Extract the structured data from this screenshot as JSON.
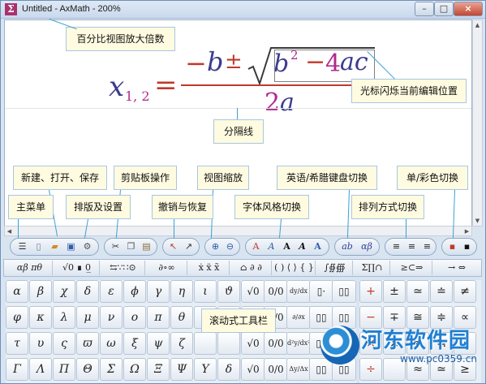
{
  "window": {
    "title": "Untitled - AxMath - 200%",
    "app_icon": "Σ",
    "min_label": "–",
    "max_label": "□",
    "close_label": "×"
  },
  "formula": {
    "x": "x",
    "sub": "1, 2",
    "eq": "=",
    "minus": "−",
    "b": "b",
    "pm": "±",
    "b2": "b",
    "exp": "2",
    "minus2": "−",
    "four": "4",
    "ac": "ac",
    "two": "2",
    "a": "a"
  },
  "callouts": {
    "zoom_percent": "百分比视图放大倍数",
    "cursor_position": "光标闪烁当前编辑位置",
    "separator": "分隔线",
    "new_open_save": "新建、打开、保存",
    "clipboard": "剪贴板操作",
    "view_zoom": "视图缩放",
    "lang_keyboard": "英语/希腊键盘切换",
    "mono_color": "单/彩色切换",
    "main_menu": "主菜单",
    "layout_settings": "排版及设置",
    "undo_redo": "撤销与恢复",
    "font_style": "字体风格切换",
    "align": "排列方式切换",
    "scroll_toolbar": "滚动式工具栏"
  },
  "toolbar": {
    "icons": [
      "menu-icon",
      "new-file-icon",
      "open-folder-icon",
      "save-icon",
      "settings-icon",
      "cut-icon",
      "copy-icon",
      "paste-icon",
      "undo-icon",
      "redo-icon",
      "zoom-in-icon",
      "zoom-out-icon",
      "font-A-red-icon",
      "font-A-italic-icon",
      "font-A-bold-icon",
      "font-A-bold-italic-icon",
      "font-A-blue-icon",
      "english-keyboard-icon",
      "greek-keyboard-icon",
      "align-left-icon",
      "align-center-icon",
      "align-right-icon",
      "color-mode-icon",
      "mono-mode-icon"
    ],
    "font_a": "A",
    "lang_ab": "ab",
    "lang_alpha": "αβ"
  },
  "category_tabs": [
    "αβ πθ",
    "√0 ∎ 0̲",
    "⇆∵∷⊙",
    "∂∘∞",
    "ẋ ẍ x̃",
    "⌂ ∂ ∂",
    "( ) ⟨ ⟩ { }",
    "∫∯∰",
    "Σ∏∩",
    "≥⊂⇒",
    "→ ⇔"
  ],
  "symbols": [
    [
      "α",
      "β",
      "χ",
      "δ",
      "ε",
      "ϕ",
      "γ",
      "η",
      "ι",
      "ϑ"
    ],
    [
      "φ",
      "κ",
      "λ",
      "μ",
      "ν",
      "ο",
      "π",
      "θ",
      "",
      ""
    ],
    [
      "τ",
      "υ",
      "ς",
      "ϖ",
      "ω",
      "ξ",
      "ψ",
      "ζ",
      "",
      ""
    ],
    [
      "Γ",
      "Λ",
      "Π",
      "Θ",
      "Σ",
      "Ω",
      "Ξ",
      "Ψ",
      "Υ",
      "δ"
    ]
  ],
  "struct_symbols": [
    [
      "√0",
      "0/0",
      "dy/dx",
      "▯·",
      "▯▯"
    ],
    [
      "√0",
      "0/0",
      "∂/∂x",
      "▯▯",
      "▯▯"
    ],
    [
      "√0",
      "0/0",
      "d²y/dx²",
      "▯▯",
      "▯▯"
    ],
    [
      "√0",
      "0/0",
      "Δy/Δx",
      "▯▯",
      "▯▯"
    ]
  ],
  "op_symbols": [
    [
      "+",
      "±",
      "≃",
      "≐",
      "≠"
    ],
    [
      "−",
      "∓",
      "≅",
      "≑",
      "∝"
    ],
    [
      "×",
      "×",
      "≈",
      "≒",
      ""
    ],
    [
      "÷",
      "",
      "≈",
      "≃",
      "≥"
    ]
  ],
  "watermark": {
    "title": "河东软件园",
    "url": "www.pc0359.cn"
  }
}
